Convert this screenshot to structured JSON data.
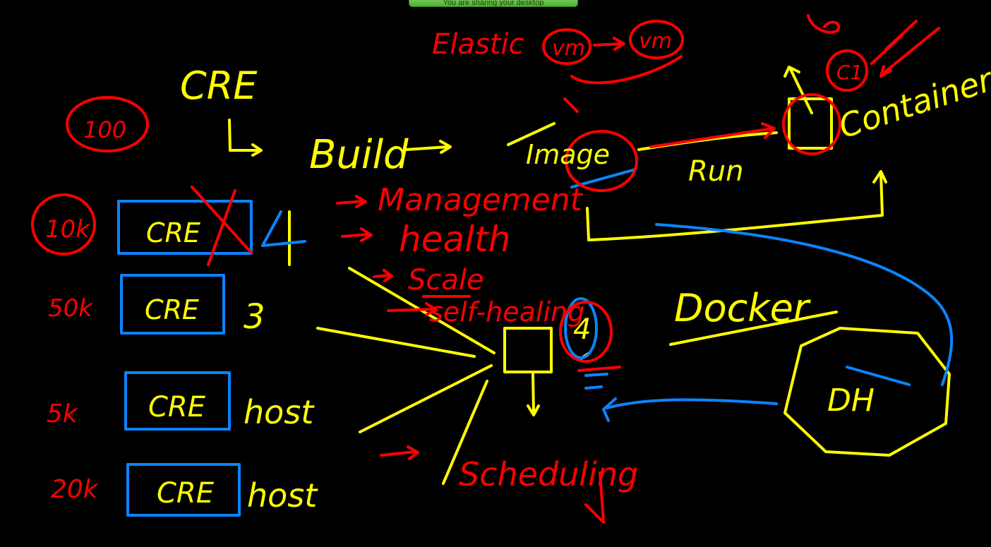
{
  "banner": {
    "text": "You are sharing your desktop"
  },
  "colors": {
    "background": "#000000",
    "yellow_ink": "#ffff00",
    "red_ink": "#ff0000",
    "blue_ink": "#0a84ff",
    "banner_green": "#5cbf3a"
  },
  "labels": {
    "cre_title": "CRE",
    "build": "Build",
    "image": "Image",
    "run": "Run",
    "container": "Container",
    "docker": "Docker",
    "dh": "DH",
    "elastic": "Elastic",
    "vm_a": "vm",
    "vm_b": "vm",
    "management": "Management",
    "health": "health",
    "scale": "Scale",
    "self_healing": "self-healing",
    "scheduling": "Scheduling",
    "c1": "C1",
    "count_100": "100",
    "count_10k": "10k",
    "count_50k": "50k",
    "count_5k": "5k",
    "count_20k": "20k",
    "num_4": "4",
    "num_3": "3",
    "num_4_small": "4",
    "host_1": "host",
    "host_2": "host"
  },
  "cre_boxes": [
    {
      "label": "CRE"
    },
    {
      "label": "CRE"
    },
    {
      "label": "CRE"
    },
    {
      "label": "CRE"
    }
  ]
}
